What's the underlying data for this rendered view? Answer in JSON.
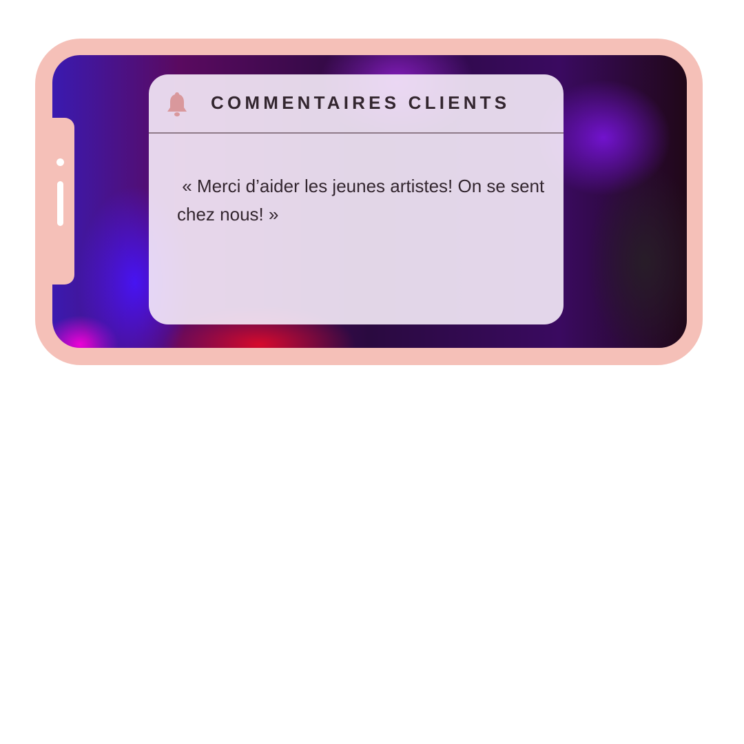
{
  "card": {
    "icon": "bell-icon",
    "title": "COMMENTAIRES CLIENTS",
    "quote": " « Merci d’aider les jeunes artistes! On se sent chez nous! »"
  },
  "colors": {
    "frame": "#f5c0b8",
    "bell": "#d9989c",
    "text": "#33262f"
  }
}
